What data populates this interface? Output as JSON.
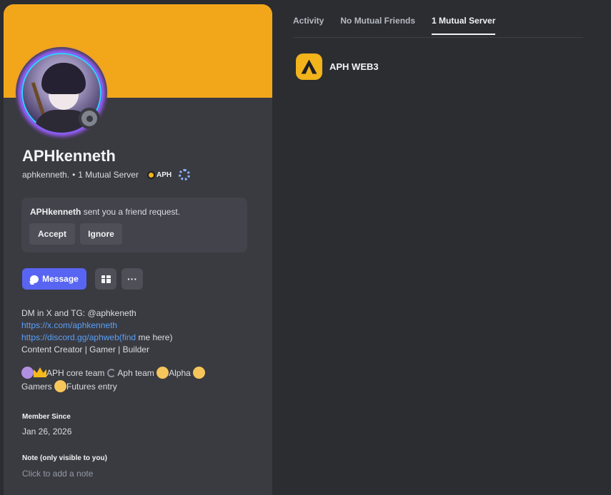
{
  "profile": {
    "display_name": "APHkenneth",
    "username": "aphkenneth.",
    "separator": "•",
    "mutual_servers": "1 Mutual Server",
    "server_tag": "APH",
    "status": "offline"
  },
  "friend_request": {
    "username": "APHkenneth",
    "text": "sent you a friend request.",
    "accept_label": "Accept",
    "ignore_label": "Ignore"
  },
  "actions": {
    "message_label": "Message",
    "more_label": "···"
  },
  "bio": {
    "line1": "DM in X and TG: @aphkeneth",
    "link1": "https://x.com/aphkenneth",
    "link2": "https://discord.gg/aphweb(find",
    "link2_suffix": " me here)",
    "line4": "Content Creator | Gamer | Builder"
  },
  "roles": {
    "core_team": "APH core team",
    "aph_team": " Aph team ",
    "alpha": "Alpha ",
    "gamers": "Gamers ",
    "futures": "Futures entry"
  },
  "member_since": {
    "label": "Member Since",
    "value": "Jan 26, 2026"
  },
  "note": {
    "label": "Note (only visible to you)",
    "placeholder": "Click to add a note"
  },
  "tabs": [
    {
      "label": "Activity",
      "active": false
    },
    {
      "label": "No Mutual Friends",
      "active": false
    },
    {
      "label": "1 Mutual Server",
      "active": true
    }
  ],
  "mutual_servers_list": [
    {
      "name": "APH WEB3",
      "icon": "aph-logo-icon"
    }
  ],
  "colors": {
    "banner": "#f2a71b",
    "accent": "#5865f2",
    "link": "#5aa0f5"
  }
}
